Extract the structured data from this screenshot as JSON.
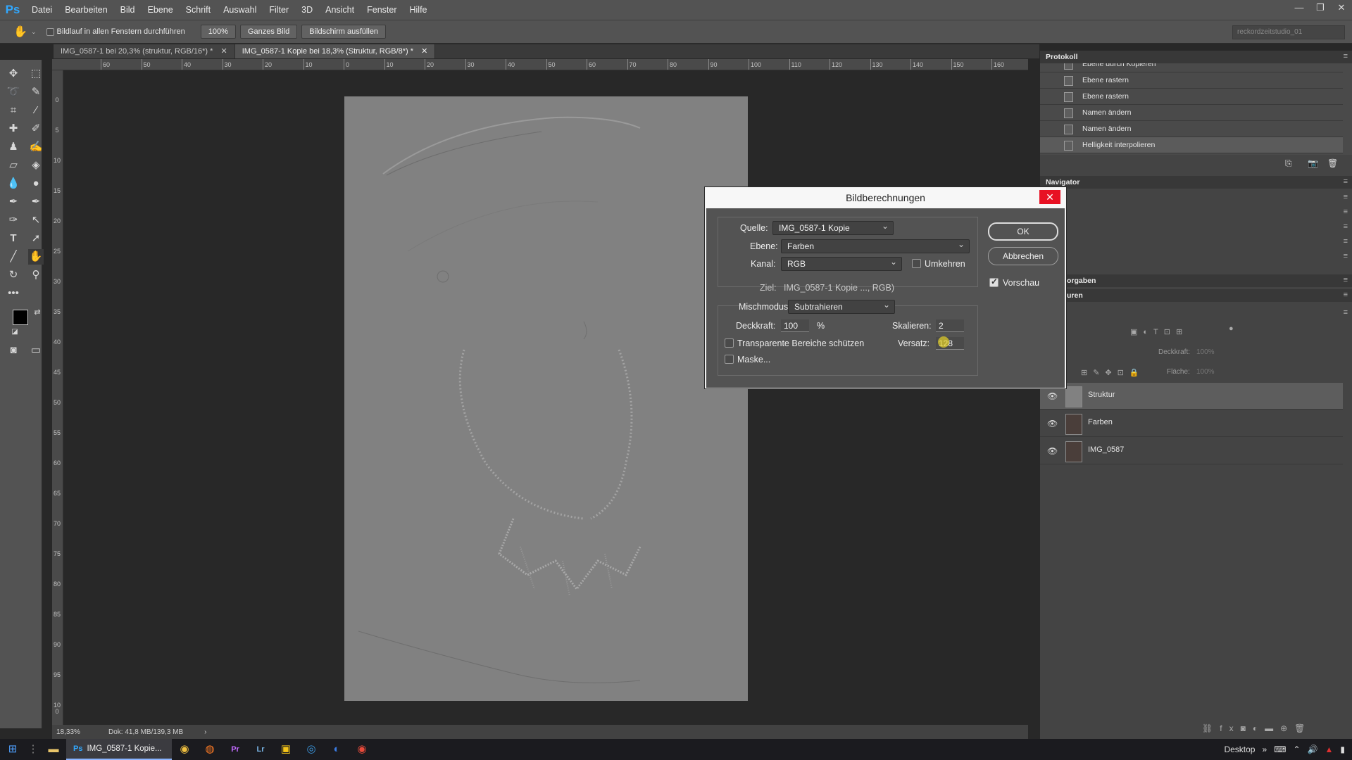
{
  "app": {
    "logo": "Ps"
  },
  "menu": [
    "Datei",
    "Bearbeiten",
    "Bild",
    "Ebene",
    "Schrift",
    "Auswahl",
    "Filter",
    "3D",
    "Ansicht",
    "Fenster",
    "Hilfe"
  ],
  "options": {
    "scroll_all_label": "Bildlauf in allen Fenstern durchführen",
    "zoom_btn": "100%",
    "fit_btn": "Ganzes Bild",
    "fill_btn": "Bildschirm ausfüllen",
    "workspace": "reckordzeitstudio_01"
  },
  "tabs": [
    {
      "label": "IMG_0587-1 bei 20,3% (struktur, RGB/16*) *"
    },
    {
      "label": "IMG_0587-1 Kopie bei 18,3% (Struktur, RGB/8*) *"
    }
  ],
  "ruler_top": [
    "60",
    "50",
    "40",
    "30",
    "20",
    "10",
    "0",
    "10",
    "20",
    "30",
    "40",
    "50",
    "60",
    "70",
    "80",
    "90",
    "100",
    "110",
    "120",
    "130",
    "140",
    "150",
    "160"
  ],
  "ruler_left": [
    "0",
    "5",
    "10",
    "15",
    "20",
    "25",
    "30",
    "35",
    "40",
    "45",
    "50",
    "55",
    "60",
    "65",
    "70",
    "75",
    "80",
    "85",
    "90",
    "95",
    "100"
  ],
  "status": {
    "zoom": "18,33%",
    "doc": "Dok: 41,8 MB/139,3 MB"
  },
  "history": {
    "title": "Protokoll",
    "items": [
      "Ebene durch Kopieren",
      "Ebene rastern",
      "Ebene rastern",
      "Namen ändern",
      "Namen ändern",
      "Helligkeit interpolieren"
    ]
  },
  "navigator": {
    "title": "Navigator"
  },
  "partial_panels": [
    "orgaben",
    "uren"
  ],
  "layers_panel": {
    "opacity_label": "Deckkraft:",
    "opacity_val": "100%",
    "fill_label": "Fläche:",
    "fill_val": "100%"
  },
  "layers": [
    {
      "name": "Struktur",
      "selected": true
    },
    {
      "name": "Farben",
      "selected": false
    },
    {
      "name": "IMG_0587",
      "selected": false
    }
  ],
  "dialog": {
    "title": "Bildberechnungen",
    "source_label": "Quelle:",
    "source_value": "IMG_0587-1 Kopie",
    "layer_label": "Ebene:",
    "layer_value": "Farben",
    "channel_label": "Kanal:",
    "channel_value": "RGB",
    "invert_label": "Umkehren",
    "target_label": "Ziel:",
    "target_value": "IMG_0587-1 Kopie ..., RGB)",
    "blend_label": "Mischmodus:",
    "blend_value": "Subtrahieren",
    "opacity_label": "Deckkraft:",
    "opacity_value": "100",
    "opacity_unit": "%",
    "scale_label": "Skalieren:",
    "scale_value": "2",
    "offset_label": "Versatz:",
    "offset_value": "128",
    "preserve_label": "Transparente Bereiche schützen",
    "mask_label": "Maske...",
    "ok": "OK",
    "cancel": "Abbrechen",
    "preview_label": "Vorschau",
    "preview_checked": true,
    "invert_checked": false,
    "preserve_checked": false,
    "mask_checked": false
  },
  "taskbar": {
    "active_label": "IMG_0587-1 Kopie...",
    "desktop": "Desktop"
  }
}
